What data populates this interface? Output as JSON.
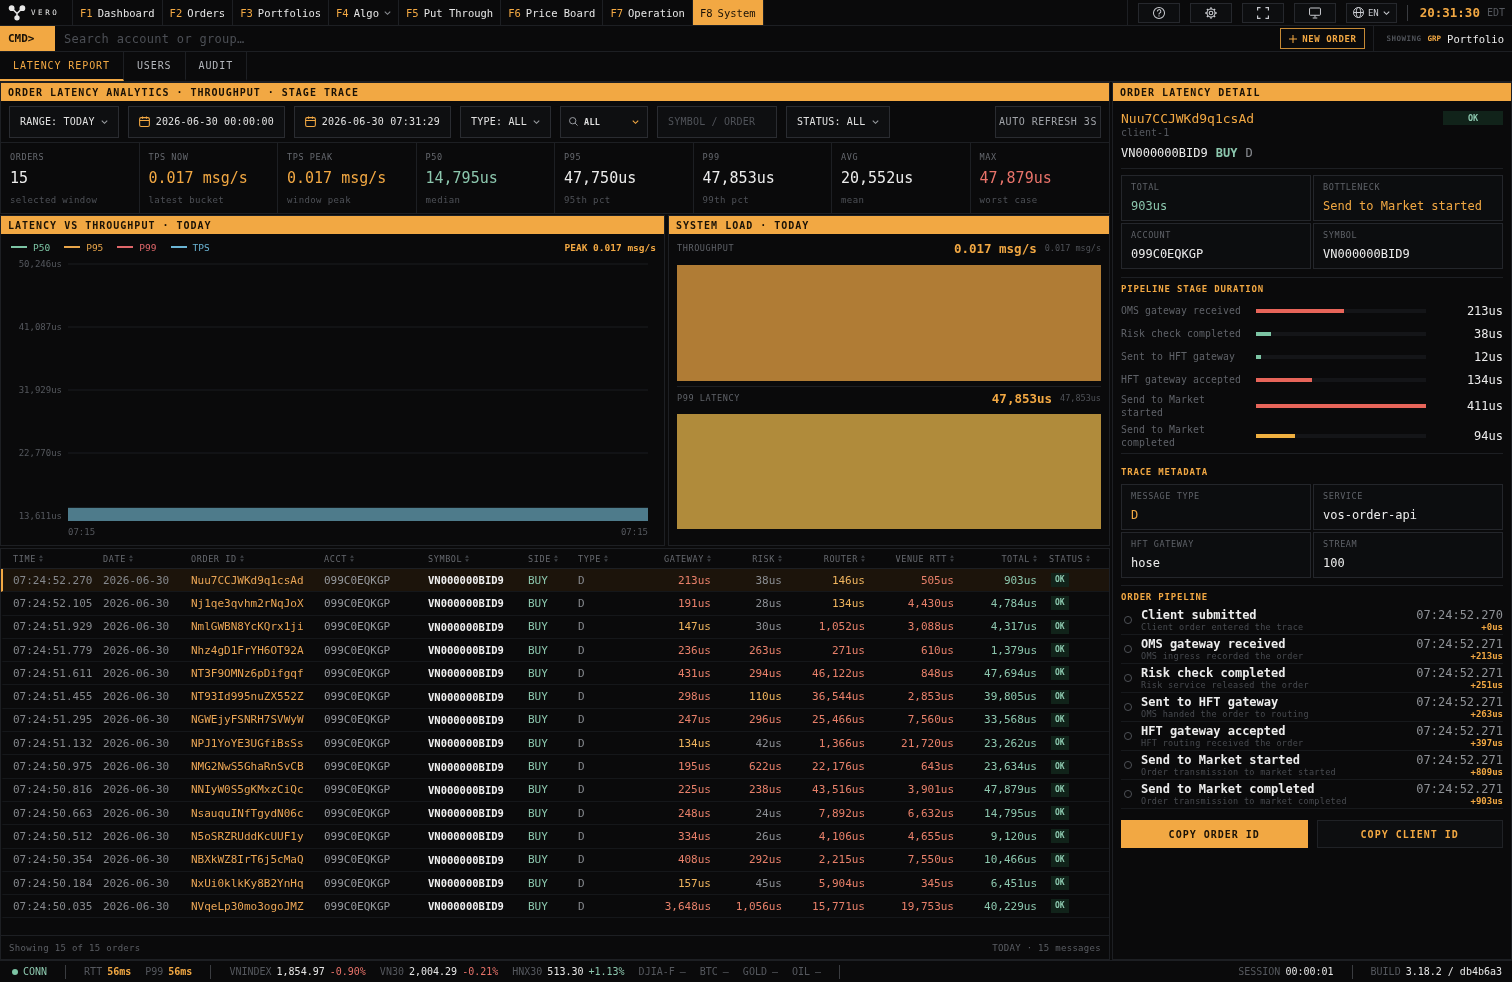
{
  "top_bar": {
    "logo": "VERO",
    "nav": [
      {
        "key": "F1",
        "label": "Dashboard",
        "selected": false,
        "dropdown": false
      },
      {
        "key": "F2",
        "label": "Orders",
        "selected": false,
        "dropdown": false
      },
      {
        "key": "F3",
        "label": "Portfolios",
        "selected": false,
        "dropdown": false
      },
      {
        "key": "F4",
        "label": "Algo",
        "selected": false,
        "dropdown": true
      },
      {
        "key": "F5",
        "label": "Put Through",
        "selected": false,
        "dropdown": false
      },
      {
        "key": "F6",
        "label": "Price Board",
        "selected": false,
        "dropdown": false
      },
      {
        "key": "F7",
        "label": "Operation",
        "selected": false,
        "dropdown": false
      },
      {
        "key": "F8",
        "label": "System",
        "selected": true,
        "dropdown": false
      }
    ],
    "language": "EN",
    "clock": "20:31:30",
    "timezone": "EDT"
  },
  "command_bar": {
    "prompt": "CMD>",
    "placeholder": "Search account or group…",
    "new_order": "NEW ORDER",
    "scope_label": "SHOWING",
    "scope_tag": "GRP",
    "scope": "Portfolio"
  },
  "tabs": [
    {
      "label": "LATENCY REPORT",
      "selected": true
    },
    {
      "label": "USERS",
      "selected": false
    },
    {
      "label": "AUDIT",
      "selected": false
    }
  ],
  "analytics": {
    "title": "ORDER LATENCY ANALYTICS · THROUGHPUT · STAGE TRACE",
    "filters": [
      {
        "kind": "select",
        "label": "RANGE: TODAY"
      },
      {
        "kind": "date",
        "value": "2026-06-30 00:00:00"
      },
      {
        "kind": "date",
        "value": "2026-06-30 07:31:29"
      },
      {
        "kind": "select",
        "label": "TYPE: ALL"
      },
      {
        "kind": "search_select",
        "value": "ALL"
      },
      {
        "kind": "input",
        "placeholder": "SYMBOL / ORDER"
      },
      {
        "kind": "select",
        "label": "STATUS: ALL"
      }
    ],
    "auto_refresh": "AUTO REFRESH 3S",
    "kpis": [
      {
        "label": "ORDERS",
        "value": "15",
        "note": "selected window",
        "color": "#ececec"
      },
      {
        "label": "TPS NOW",
        "value": "0.017 msg/s",
        "note": "latest bucket",
        "color": "#f2a843"
      },
      {
        "label": "TPS PEAK",
        "value": "0.017 msg/s",
        "note": "window peak",
        "color": "#f2a843"
      },
      {
        "label": "P50",
        "value": "14,795us",
        "note": "median",
        "color": "#8cc7ae"
      },
      {
        "label": "P95",
        "value": "47,750us",
        "note": "95th pct",
        "color": "#ececec"
      },
      {
        "label": "P99",
        "value": "47,853us",
        "note": "99th pct",
        "color": "#ececec"
      },
      {
        "label": "AVG",
        "value": "20,552us",
        "note": "mean",
        "color": "#ececec"
      },
      {
        "label": "MAX",
        "value": "47,879us",
        "note": "worst case",
        "color": "#e8736a"
      }
    ]
  },
  "latency_chart": {
    "title": "LATENCY VS THROUGHPUT · TODAY",
    "legend": [
      {
        "label": "P50",
        "color": "#7cc4a4"
      },
      {
        "label": "P95",
        "color": "#e8a54a"
      },
      {
        "label": "P99",
        "color": "#e0676a"
      },
      {
        "label": "TPS",
        "color": "#6ab4d4"
      }
    ],
    "peak": "PEAK 0.017 msg/s",
    "chart_data": {
      "type": "bar",
      "categories": [
        null
      ],
      "values": [
        14800
      ],
      "color": "#4e7b8b",
      "yticks": [
        {
          "value": 13611,
          "label": "13,611us"
        },
        {
          "value": 22770,
          "label": "22,770us"
        },
        {
          "value": 31929,
          "label": "31,929us"
        },
        {
          "value": 41087,
          "label": "41,087us"
        },
        {
          "value": 50246,
          "label": "50,246us"
        }
      ],
      "ylim": [
        12884,
        50246
      ],
      "grid": true
    },
    "x_labels": [
      "07:15",
      "07:15"
    ]
  },
  "system_load": {
    "title": "SYSTEM LOAD · TODAY",
    "panels": [
      {
        "label": "THROUGHPUT",
        "value": "0.017 msg/s",
        "max": "0.017 msg/s",
        "color": "#b07c35"
      },
      {
        "label": "P99 LATENCY",
        "value": "47,853us",
        "max": "47,853us",
        "color": "#b08b3b"
      }
    ]
  },
  "table": {
    "columns": [
      "TIME",
      "DATE",
      "ORDER ID",
      "ACCT",
      "SYMBOL",
      "SIDE",
      "TYPE",
      "GATEWAY",
      "RISK",
      "ROUTER",
      "VENUE RTT",
      "TOTAL",
      "STATUS"
    ],
    "rows": [
      {
        "selected": true,
        "time": "07:24:52.270",
        "date": "2026-06-30",
        "order_id": "Nuu7CCJWKd9q1csAd",
        "acct": "099C0EQKGP",
        "symbol": "VN000000BID9",
        "side": "BUY",
        "type": "D",
        "gateway": {
          "text": "213us",
          "color": "#e8806a"
        },
        "risk": {
          "text": "38us",
          "color": "#8b8e93"
        },
        "router": {
          "text": "146us",
          "color": "#efb45e"
        },
        "venue_rtt": {
          "text": "505us",
          "color": "#e8806a"
        },
        "total": "903us",
        "status": "OK"
      },
      {
        "selected": false,
        "time": "07:24:52.105",
        "date": "2026-06-30",
        "order_id": "Nj1qe3qvhm2rNqJoX",
        "acct": "099C0EQKGP",
        "symbol": "VN000000BID9",
        "side": "BUY",
        "type": "D",
        "gateway": {
          "text": "191us",
          "color": "#e8806a"
        },
        "risk": {
          "text": "28us",
          "color": "#8b8e93"
        },
        "router": {
          "text": "134us",
          "color": "#efb45e"
        },
        "venue_rtt": {
          "text": "4,430us",
          "color": "#e8806a"
        },
        "total": "4,784us",
        "status": "OK"
      },
      {
        "selected": false,
        "time": "07:24:51.929",
        "date": "2026-06-30",
        "order_id": "NmlGWBN8YcKQrx1ji",
        "acct": "099C0EQKGP",
        "symbol": "VN000000BID9",
        "side": "BUY",
        "type": "D",
        "gateway": {
          "text": "147us",
          "color": "#efb45e"
        },
        "risk": {
          "text": "30us",
          "color": "#8b8e93"
        },
        "router": {
          "text": "1,052us",
          "color": "#e8806a"
        },
        "venue_rtt": {
          "text": "3,088us",
          "color": "#e8806a"
        },
        "total": "4,317us",
        "status": "OK"
      },
      {
        "selected": false,
        "time": "07:24:51.779",
        "date": "2026-06-30",
        "order_id": "Nhz4gD1FrYH6OT92A",
        "acct": "099C0EQKGP",
        "symbol": "VN000000BID9",
        "side": "BUY",
        "type": "D",
        "gateway": {
          "text": "236us",
          "color": "#e8806a"
        },
        "risk": {
          "text": "263us",
          "color": "#e8806a"
        },
        "router": {
          "text": "271us",
          "color": "#e8806a"
        },
        "venue_rtt": {
          "text": "610us",
          "color": "#e8806a"
        },
        "total": "1,379us",
        "status": "OK"
      },
      {
        "selected": false,
        "time": "07:24:51.611",
        "date": "2026-06-30",
        "order_id": "NT3F9OMNz6pDifgqf",
        "acct": "099C0EQKGP",
        "symbol": "VN000000BID9",
        "side": "BUY",
        "type": "D",
        "gateway": {
          "text": "431us",
          "color": "#e8806a"
        },
        "risk": {
          "text": "294us",
          "color": "#e8806a"
        },
        "router": {
          "text": "46,122us",
          "color": "#e8806a"
        },
        "venue_rtt": {
          "text": "848us",
          "color": "#e8806a"
        },
        "total": "47,694us",
        "status": "OK"
      },
      {
        "selected": false,
        "time": "07:24:51.455",
        "date": "2026-06-30",
        "order_id": "NT93Id995nuZX552Z",
        "acct": "099C0EQKGP",
        "symbol": "VN000000BID9",
        "side": "BUY",
        "type": "D",
        "gateway": {
          "text": "298us",
          "color": "#e8806a"
        },
        "risk": {
          "text": "110us",
          "color": "#efb45e"
        },
        "router": {
          "text": "36,544us",
          "color": "#e8806a"
        },
        "venue_rtt": {
          "text": "2,853us",
          "color": "#e8806a"
        },
        "total": "39,805us",
        "status": "OK"
      },
      {
        "selected": false,
        "time": "07:24:51.295",
        "date": "2026-06-30",
        "order_id": "NGWEjyFSNRH7SVWyW",
        "acct": "099C0EQKGP",
        "symbol": "VN000000BID9",
        "side": "BUY",
        "type": "D",
        "gateway": {
          "text": "247us",
          "color": "#e8806a"
        },
        "risk": {
          "text": "296us",
          "color": "#e8806a"
        },
        "router": {
          "text": "25,466us",
          "color": "#e8806a"
        },
        "venue_rtt": {
          "text": "7,560us",
          "color": "#e8806a"
        },
        "total": "33,568us",
        "status": "OK"
      },
      {
        "selected": false,
        "time": "07:24:51.132",
        "date": "2026-06-30",
        "order_id": "NPJ1YoYE3UGfiBsSs",
        "acct": "099C0EQKGP",
        "symbol": "VN000000BID9",
        "side": "BUY",
        "type": "D",
        "gateway": {
          "text": "134us",
          "color": "#efb45e"
        },
        "risk": {
          "text": "42us",
          "color": "#8b8e93"
        },
        "router": {
          "text": "1,366us",
          "color": "#e8806a"
        },
        "venue_rtt": {
          "text": "21,720us",
          "color": "#e8806a"
        },
        "total": "23,262us",
        "status": "OK"
      },
      {
        "selected": false,
        "time": "07:24:50.975",
        "date": "2026-06-30",
        "order_id": "NMG2NwS5GhaRnSvCB",
        "acct": "099C0EQKGP",
        "symbol": "VN000000BID9",
        "side": "BUY",
        "type": "D",
        "gateway": {
          "text": "195us",
          "color": "#e8806a"
        },
        "risk": {
          "text": "622us",
          "color": "#e8806a"
        },
        "router": {
          "text": "22,176us",
          "color": "#e8806a"
        },
        "venue_rtt": {
          "text": "643us",
          "color": "#e8806a"
        },
        "total": "23,634us",
        "status": "OK"
      },
      {
        "selected": false,
        "time": "07:24:50.816",
        "date": "2026-06-30",
        "order_id": "NNIyW0S5gKMxzCiQc",
        "acct": "099C0EQKGP",
        "symbol": "VN000000BID9",
        "side": "BUY",
        "type": "D",
        "gateway": {
          "text": "225us",
          "color": "#e8806a"
        },
        "risk": {
          "text": "238us",
          "color": "#e8806a"
        },
        "router": {
          "text": "43,516us",
          "color": "#e8806a"
        },
        "venue_rtt": {
          "text": "3,901us",
          "color": "#e8806a"
        },
        "total": "47,879us",
        "status": "OK"
      },
      {
        "selected": false,
        "time": "07:24:50.663",
        "date": "2026-06-30",
        "order_id": "NsauquINfTgydN06c",
        "acct": "099C0EQKGP",
        "symbol": "VN000000BID9",
        "side": "BUY",
        "type": "D",
        "gateway": {
          "text": "248us",
          "color": "#e8806a"
        },
        "risk": {
          "text": "24us",
          "color": "#8b8e93"
        },
        "router": {
          "text": "7,892us",
          "color": "#e8806a"
        },
        "venue_rtt": {
          "text": "6,632us",
          "color": "#e8806a"
        },
        "total": "14,795us",
        "status": "OK"
      },
      {
        "selected": false,
        "time": "07:24:50.512",
        "date": "2026-06-30",
        "order_id": "N5oSRZRUddKcUUF1y",
        "acct": "099C0EQKGP",
        "symbol": "VN000000BID9",
        "side": "BUY",
        "type": "D",
        "gateway": {
          "text": "334us",
          "color": "#e8806a"
        },
        "risk": {
          "text": "26us",
          "color": "#8b8e93"
        },
        "router": {
          "text": "4,106us",
          "color": "#e8806a"
        },
        "venue_rtt": {
          "text": "4,655us",
          "color": "#e8806a"
        },
        "total": "9,120us",
        "status": "OK"
      },
      {
        "selected": false,
        "time": "07:24:50.354",
        "date": "2026-06-30",
        "order_id": "NBXkWZ8IrT6j5cMaQ",
        "acct": "099C0EQKGP",
        "symbol": "VN000000BID9",
        "side": "BUY",
        "type": "D",
        "gateway": {
          "text": "408us",
          "color": "#e8806a"
        },
        "risk": {
          "text": "292us",
          "color": "#e8806a"
        },
        "router": {
          "text": "2,215us",
          "color": "#e8806a"
        },
        "venue_rtt": {
          "text": "7,550us",
          "color": "#e8806a"
        },
        "total": "10,466us",
        "status": "OK"
      },
      {
        "selected": false,
        "time": "07:24:50.184",
        "date": "2026-06-30",
        "order_id": "NxUi0klkKy8B2YnHq",
        "acct": "099C0EQKGP",
        "symbol": "VN000000BID9",
        "side": "BUY",
        "type": "D",
        "gateway": {
          "text": "157us",
          "color": "#efb45e"
        },
        "risk": {
          "text": "45us",
          "color": "#8b8e93"
        },
        "router": {
          "text": "5,904us",
          "color": "#e8806a"
        },
        "venue_rtt": {
          "text": "345us",
          "color": "#e8806a"
        },
        "total": "6,451us",
        "status": "OK"
      },
      {
        "selected": false,
        "time": "07:24:50.035",
        "date": "2026-06-30",
        "order_id": "NVqeLp30mo3ogoJMZ",
        "acct": "099C0EQKGP",
        "symbol": "VN000000BID9",
        "side": "BUY",
        "type": "D",
        "gateway": {
          "text": "3,648us",
          "color": "#e8806a"
        },
        "risk": {
          "text": "1,056us",
          "color": "#e8806a"
        },
        "router": {
          "text": "15,771us",
          "color": "#e8806a"
        },
        "venue_rtt": {
          "text": "19,753us",
          "color": "#e8806a"
        },
        "total": "40,229us",
        "status": "OK"
      }
    ],
    "footer_left": "Showing 15 of 15 orders",
    "footer_right": "TODAY · 15 messages"
  },
  "detail": {
    "title": "ORDER LATENCY DETAIL",
    "order_id": "Nuu7CCJWKd9q1csAd",
    "status": "OK",
    "client": "client-1",
    "symbol": "VN000000BID9",
    "side": "BUY",
    "type": "D",
    "summary": [
      {
        "label": "TOTAL",
        "value": "903us",
        "color": "#8cc7ae"
      },
      {
        "label": "BOTTLENECK",
        "value": "Send to Market started",
        "color": "#f2a843"
      },
      {
        "label": "ACCOUNT",
        "value": "099C0EQKGP",
        "color": "#ececec"
      },
      {
        "label": "SYMBOL",
        "value": "VN000000BID9",
        "color": "#ececec"
      }
    ],
    "stages_title": "PIPELINE STAGE DURATION",
    "stages": [
      {
        "label": "OMS gateway received",
        "level": 0.52,
        "value": "213us",
        "color": "#e8655a"
      },
      {
        "label": "Risk check completed",
        "level": 0.09,
        "value": "38us",
        "color": "#7cc4a4"
      },
      {
        "label": "Sent to HFT gateway",
        "level": 0.03,
        "value": "12us",
        "color": "#7cc4a4"
      },
      {
        "label": "HFT gateway accepted",
        "level": 0.33,
        "value": "134us",
        "color": "#e8655a"
      },
      {
        "label": "Send to Market started",
        "level": 1,
        "value": "411us",
        "color": "#e8655a"
      },
      {
        "label": "Send to Market completed",
        "level": 0.23,
        "value": "94us",
        "color": "#f0b040"
      }
    ],
    "metadata_title": "TRACE METADATA",
    "metadata": [
      {
        "label": "MESSAGE TYPE",
        "value": "D",
        "color": "#f2a843"
      },
      {
        "label": "SERVICE",
        "value": "vos-order-api",
        "color": "#ececec"
      },
      {
        "label": "HFT GATEWAY",
        "value": "hose",
        "color": "#ececec"
      },
      {
        "label": "STREAM",
        "value": "100",
        "color": "#ececec"
      }
    ],
    "pipeline_title": "ORDER PIPELINE",
    "pipeline": [
      {
        "title": "Client submitted",
        "description": "Client order entered the trace",
        "time": "07:24:52.270",
        "delta": "+0us"
      },
      {
        "title": "OMS gateway received",
        "description": "OMS ingress recorded the order",
        "time": "07:24:52.271",
        "delta": "+213us"
      },
      {
        "title": "Risk check completed",
        "description": "Risk service released the order",
        "time": "07:24:52.271",
        "delta": "+251us"
      },
      {
        "title": "Sent to HFT gateway",
        "description": "OMS handed the order to routing",
        "time": "07:24:52.271",
        "delta": "+263us"
      },
      {
        "title": "HFT gateway accepted",
        "description": "HFT routing received the order",
        "time": "07:24:52.271",
        "delta": "+397us"
      },
      {
        "title": "Send to Market started",
        "description": "Order transmission to market started",
        "time": "07:24:52.271",
        "delta": "+809us"
      },
      {
        "title": "Send to Market completed",
        "description": "Order transmission to market completed",
        "time": "07:24:52.271",
        "delta": "+903us"
      }
    ],
    "actions": [
      {
        "label": "COPY ORDER ID",
        "kind": "primary"
      },
      {
        "label": "COPY CLIENT ID",
        "kind": "secondary"
      }
    ]
  },
  "status_bar": {
    "connection": {
      "label": "CONN",
      "color": "#7cc4a4"
    },
    "metrics": [
      {
        "label": "RTT",
        "value": "56ms"
      },
      {
        "label": "P99",
        "value": "56ms"
      }
    ],
    "tickers": [
      {
        "name": "VNINDEX",
        "value": "1,854.97",
        "change": "-0.90%",
        "color": "#e8736a",
        "available": true
      },
      {
        "name": "VN30",
        "value": "2,004.29",
        "change": "-0.21%",
        "color": "#e8736a",
        "available": true
      },
      {
        "name": "HNX30",
        "value": "513.30",
        "change": "+1.13%",
        "color": "#8cc7ae",
        "available": true
      },
      {
        "name": "DJIA-F",
        "value": "—",
        "available": false
      },
      {
        "name": "BTC",
        "value": "—",
        "available": false
      },
      {
        "name": "GOLD",
        "value": "—",
        "available": false
      },
      {
        "name": "OIL",
        "value": "—",
        "available": false
      }
    ],
    "session": {
      "label": "SESSION",
      "value": "00:00:01"
    },
    "build": {
      "label": "BUILD",
      "value": "3.18.2 / db4b6a3"
    }
  }
}
